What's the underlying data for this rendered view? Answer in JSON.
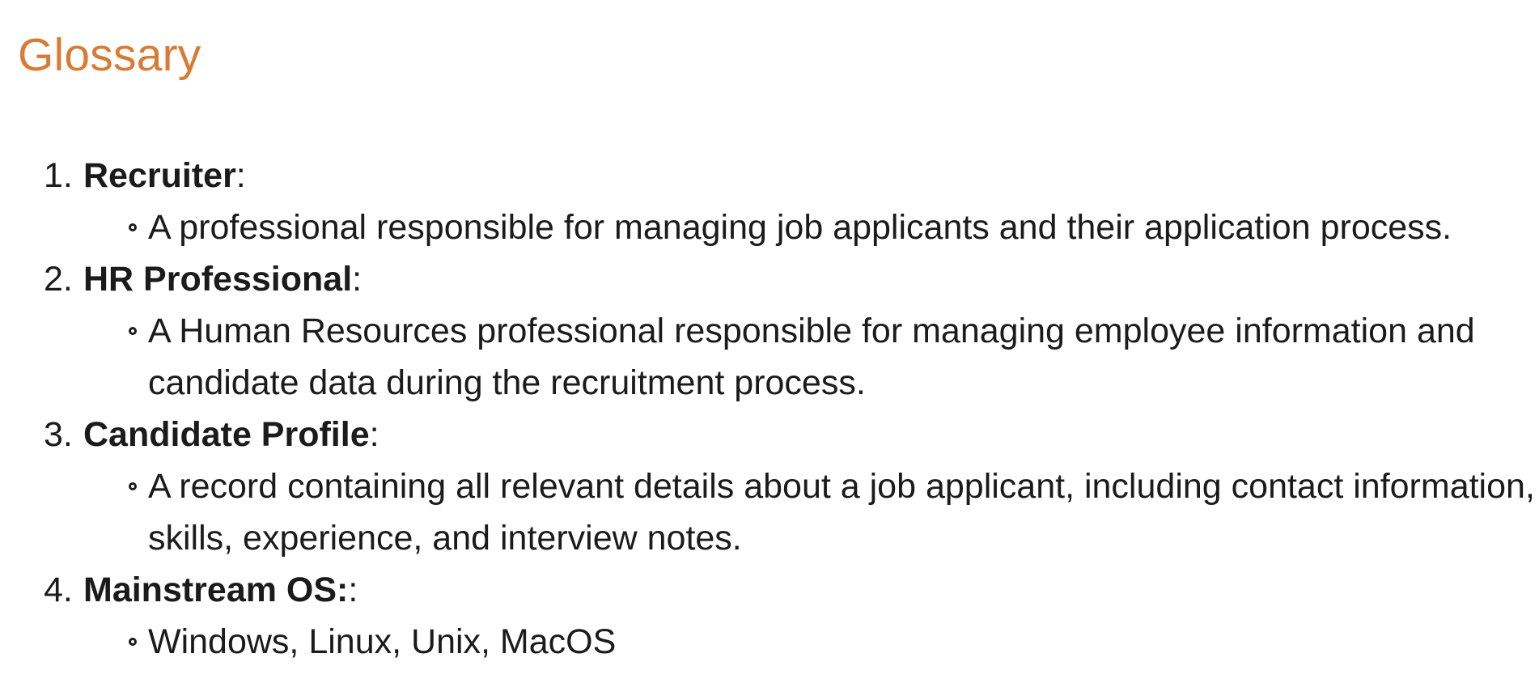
{
  "page": {
    "title": "Glossary"
  },
  "glossary": [
    {
      "number": "1.",
      "term": "Recruiter",
      "suffix": ":",
      "definition": "A professional responsible for managing job applicants and their application process."
    },
    {
      "number": "2.",
      "term": "HR Professional",
      "suffix": ":",
      "definition": "A Human Resources professional responsible for managing employee information and candidate data during the recruitment process."
    },
    {
      "number": "3.",
      "term": "Candidate Profile",
      "suffix": ":",
      "definition": "A record containing all relevant details about a job applicant, including contact information, skills, experience, and interview notes."
    },
    {
      "number": "4.",
      "term": "Mainstream OS:",
      "suffix": ":",
      "definition": "Windows, Linux, Unix, MacOS"
    }
  ],
  "colors": {
    "title": "#d97b35",
    "text": "#1b1b1b",
    "background": "#ffffff"
  }
}
